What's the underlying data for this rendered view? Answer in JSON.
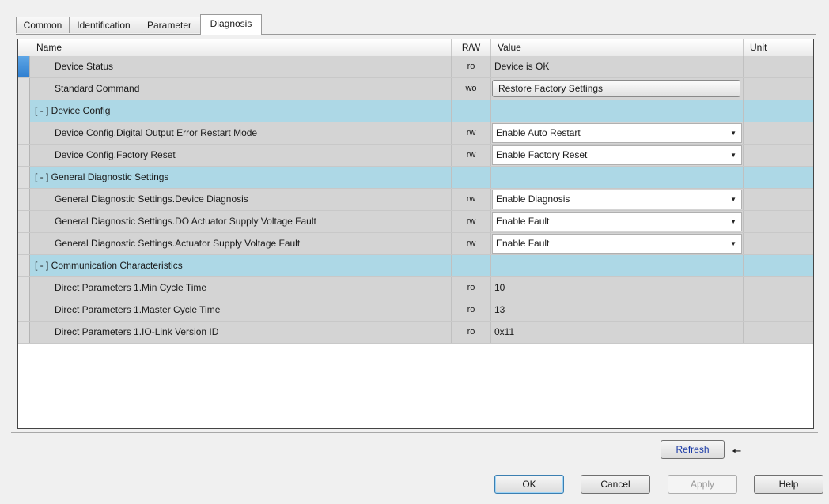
{
  "tabs": [
    "Common",
    "Identification",
    "Parameter",
    "Diagnosis"
  ],
  "columns": {
    "name": "Name",
    "rw": "R/W",
    "value": "Value",
    "unit": "Unit"
  },
  "rows": [
    {
      "name": "Device Status",
      "rw": "ro",
      "value": "Device is OK"
    },
    {
      "name": "Standard Command",
      "rw": "wo",
      "button": "Restore Factory Settings"
    },
    {
      "group": "[ - ]  Device Config"
    },
    {
      "name": "Device Config.Digital Output Error Restart Mode",
      "rw": "rw",
      "select": "Enable Auto Restart"
    },
    {
      "name": "Device Config.Factory Reset",
      "rw": "rw",
      "select": "Enable Factory Reset"
    },
    {
      "group": "[ - ]  General Diagnostic Settings"
    },
    {
      "name": "General Diagnostic Settings.Device Diagnosis",
      "rw": "rw",
      "select": "Enable Diagnosis"
    },
    {
      "name": "General Diagnostic Settings.DO Actuator Supply Voltage Fault",
      "rw": "rw",
      "select": "Enable Fault"
    },
    {
      "name": "General Diagnostic Settings.Actuator Supply Voltage Fault",
      "rw": "rw",
      "select": "Enable Fault"
    },
    {
      "group": "[ - ]  Communication Characteristics"
    },
    {
      "name": "Direct Parameters 1.Min Cycle Time",
      "rw": "ro",
      "value": "10"
    },
    {
      "name": "Direct Parameters 1.Master Cycle Time",
      "rw": "ro",
      "value": "13"
    },
    {
      "name": "Direct Parameters 1.IO-Link Version ID",
      "rw": "ro",
      "value": "0x11"
    }
  ],
  "buttons": {
    "refresh": "Refresh",
    "ok": "OK",
    "cancel": "Cancel",
    "apply": "Apply",
    "help": "Help"
  },
  "icons": {
    "dropdown": "chevron-down-icon",
    "refresh_pointer": "arrow-left-icon"
  }
}
